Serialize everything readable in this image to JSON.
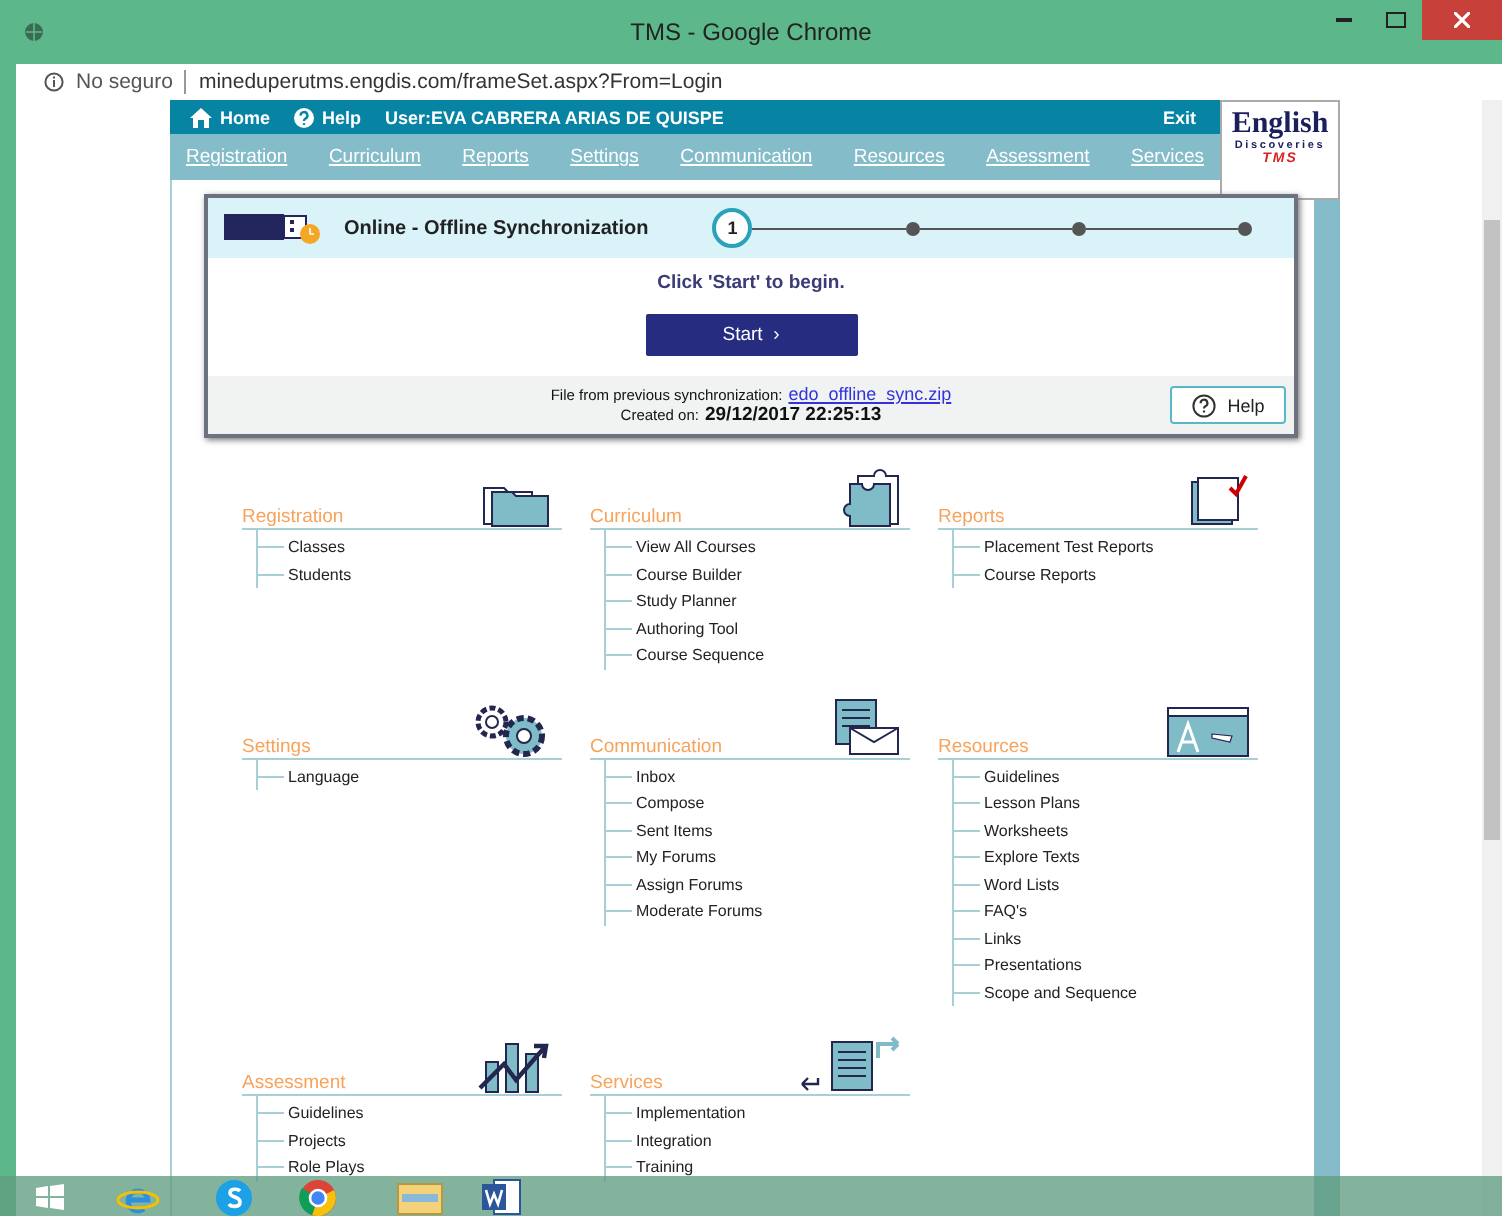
{
  "window": {
    "title": "TMS - Google Chrome"
  },
  "address_bar": {
    "security": "No seguro",
    "url": "mineduperutms.engdis.com/frameSet.aspx?From=Login"
  },
  "header": {
    "home": "Home",
    "help": "Help",
    "user": "User:EVA CABRERA ARIAS DE QUISPE",
    "exit": "Exit"
  },
  "logo": {
    "word": "English",
    "sub": "Discoveries",
    "product": "TMS"
  },
  "nav": [
    "Registration",
    "Curriculum",
    "Reports",
    "Settings",
    "Communication",
    "Resources",
    "Assessment",
    "Services"
  ],
  "sync_panel": {
    "title": "Online - Offline Synchronization",
    "steps": [
      {
        "number": "1",
        "current": true
      },
      {
        "current": false
      },
      {
        "current": false
      },
      {
        "current": false
      }
    ],
    "instruction": "Click 'Start' to begin.",
    "start_button": "Start",
    "start_caret": "›",
    "file_label": "File from previous synchronization:",
    "file_link": "edo_offline_sync.zip",
    "created_label": "Created on:",
    "created_value": "29/12/2017 22:25:13",
    "help_button": "Help"
  },
  "sections": [
    {
      "kind": "folder",
      "title": "Registration",
      "items": [
        "Classes",
        "Students"
      ]
    },
    {
      "kind": "puzzle",
      "title": "Curriculum",
      "items": [
        "View All Courses",
        "Course Builder",
        "Study Planner",
        "Authoring Tool",
        "Course Sequence"
      ]
    },
    {
      "kind": "report",
      "title": "Reports",
      "items": [
        "Placement Test Reports",
        "Course Reports"
      ]
    },
    {
      "kind": "gears",
      "title": "Settings",
      "items": [
        "Language"
      ]
    },
    {
      "kind": "mail",
      "title": "Communication",
      "items": [
        "Inbox",
        "Compose",
        "Sent Items",
        "My Forums",
        "Assign Forums",
        "Moderate Forums"
      ]
    },
    {
      "kind": "board",
      "title": "Resources",
      "items": [
        "Guidelines",
        "Lesson Plans",
        "Worksheets",
        "Explore Texts",
        "Word Lists",
        "FAQ's",
        "Links",
        "Presentations",
        "Scope and Sequence"
      ]
    },
    {
      "kind": "chart",
      "title": "Assessment",
      "items": [
        "Guidelines",
        "Projects",
        "Role Plays"
      ]
    },
    {
      "kind": "document",
      "title": "Services",
      "items": [
        "Implementation",
        "Integration",
        "Training"
      ]
    }
  ]
}
